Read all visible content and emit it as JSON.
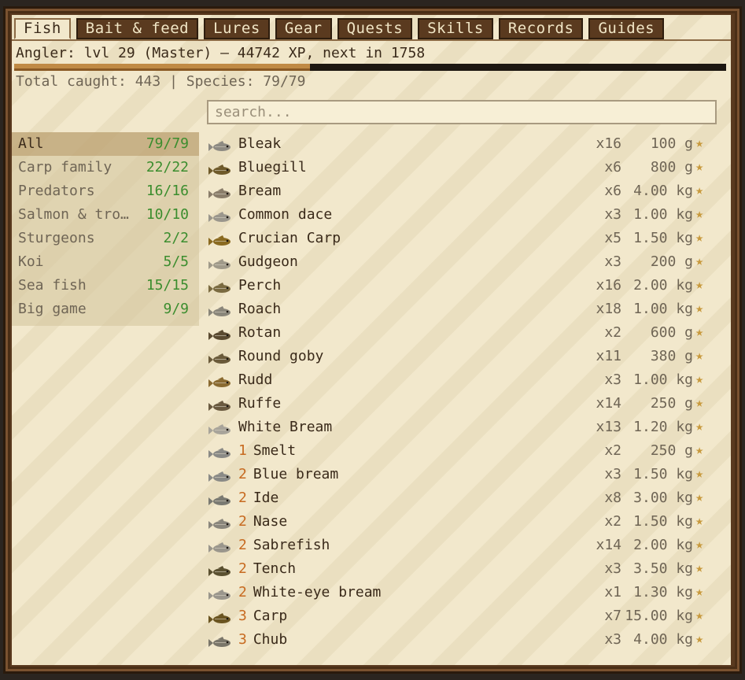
{
  "tabs": [
    "Fish",
    "Bait & feed",
    "Lures",
    "Gear",
    "Quests",
    "Skills",
    "Records",
    "Guides"
  ],
  "active_tab": "Fish",
  "angler": {
    "level_line": "Angler: lvl 29 (Master) — 44742 XP, next in 1758",
    "xp_progress": 0.415
  },
  "stats_line": "Total caught: 443 | Species: 79/79",
  "search": {
    "placeholder": "search..."
  },
  "categories": [
    {
      "name": "All",
      "count": "79/79",
      "active": true
    },
    {
      "name": "Carp family",
      "count": "22/22",
      "active": false
    },
    {
      "name": "Predators",
      "count": "16/16",
      "active": false
    },
    {
      "name": "Salmon & trout",
      "count": "10/10",
      "active": false
    },
    {
      "name": "Sturgeons",
      "count": "2/2",
      "active": false
    },
    {
      "name": "Koi",
      "count": "5/5",
      "active": false
    },
    {
      "name": "Sea fish",
      "count": "15/15",
      "active": false
    },
    {
      "name": "Big game",
      "count": "9/9",
      "active": false
    }
  ],
  "fish": [
    {
      "tier": "",
      "name": "Bleak",
      "count": "x16",
      "weight": "100 g",
      "icon": "bleak-icon",
      "color": "#8d8a82"
    },
    {
      "tier": "",
      "name": "Bluegill",
      "count": "x6",
      "weight": "800 g",
      "icon": "bluegill-icon",
      "color": "#6f5a2a"
    },
    {
      "tier": "",
      "name": "Bream",
      "count": "x6",
      "weight": "4.00 kg",
      "icon": "bream-icon",
      "color": "#8a7d6a"
    },
    {
      "tier": "",
      "name": "Common dace",
      "count": "x3",
      "weight": "1.00 kg",
      "icon": "dace-icon",
      "color": "#9a968c"
    },
    {
      "tier": "",
      "name": "Crucian Carp",
      "count": "x5",
      "weight": "1.50 kg",
      "icon": "crucian-carp-icon",
      "color": "#8a6a20"
    },
    {
      "tier": "",
      "name": "Gudgeon",
      "count": "x3",
      "weight": "200 g",
      "icon": "gudgeon-icon",
      "color": "#a09a8a"
    },
    {
      "tier": "",
      "name": "Perch",
      "count": "x16",
      "weight": "2.00 kg",
      "icon": "perch-icon",
      "color": "#7a6a40"
    },
    {
      "tier": "",
      "name": "Roach",
      "count": "x18",
      "weight": "1.00 kg",
      "icon": "roach-icon",
      "color": "#8a867a"
    },
    {
      "tier": "",
      "name": "Rotan",
      "count": "x2",
      "weight": "600 g",
      "icon": "rotan-icon",
      "color": "#5a4a30"
    },
    {
      "tier": "",
      "name": "Round goby",
      "count": "x11",
      "weight": "380 g",
      "icon": "round-goby-icon",
      "color": "#6a5a3a"
    },
    {
      "tier": "",
      "name": "Rudd",
      "count": "x3",
      "weight": "1.00 kg",
      "icon": "rudd-icon",
      "color": "#8a6a30"
    },
    {
      "tier": "",
      "name": "Ruffe",
      "count": "x14",
      "weight": "250 g",
      "icon": "ruffe-icon",
      "color": "#6a5a40"
    },
    {
      "tier": "",
      "name": "White Bream",
      "count": "x13",
      "weight": "1.20 kg",
      "icon": "white-bream-icon",
      "color": "#a8a49a"
    },
    {
      "tier": "1",
      "name": "Smelt",
      "count": "x2",
      "weight": "250 g",
      "icon": "smelt-icon",
      "color": "#8a8a86"
    },
    {
      "tier": "2",
      "name": "Blue bream",
      "count": "x3",
      "weight": "1.50 kg",
      "icon": "blue-bream-icon",
      "color": "#8a8a86"
    },
    {
      "tier": "2",
      "name": "Ide",
      "count": "x8",
      "weight": "3.00 kg",
      "icon": "ide-icon",
      "color": "#7a7a72"
    },
    {
      "tier": "2",
      "name": "Nase",
      "count": "x2",
      "weight": "1.50 kg",
      "icon": "nase-icon",
      "color": "#8a867c"
    },
    {
      "tier": "2",
      "name": "Sabrefish",
      "count": "x14",
      "weight": "2.00 kg",
      "icon": "sabrefish-icon",
      "color": "#9a968c"
    },
    {
      "tier": "2",
      "name": "Tench",
      "count": "x3",
      "weight": "3.50 kg",
      "icon": "tench-icon",
      "color": "#5a5030"
    },
    {
      "tier": "2",
      "name": "White-eye bream",
      "count": "x1",
      "weight": "1.30 kg",
      "icon": "white-eye-bream-icon",
      "color": "#9a968c"
    },
    {
      "tier": "3",
      "name": "Carp",
      "count": "x7",
      "weight": "15.00 kg",
      "icon": "carp-icon",
      "color": "#6a5420"
    },
    {
      "tier": "3",
      "name": "Chub",
      "count": "x3",
      "weight": "4.00 kg",
      "icon": "chub-icon",
      "color": "#7a766a"
    }
  ],
  "star_icon": "star-icon"
}
